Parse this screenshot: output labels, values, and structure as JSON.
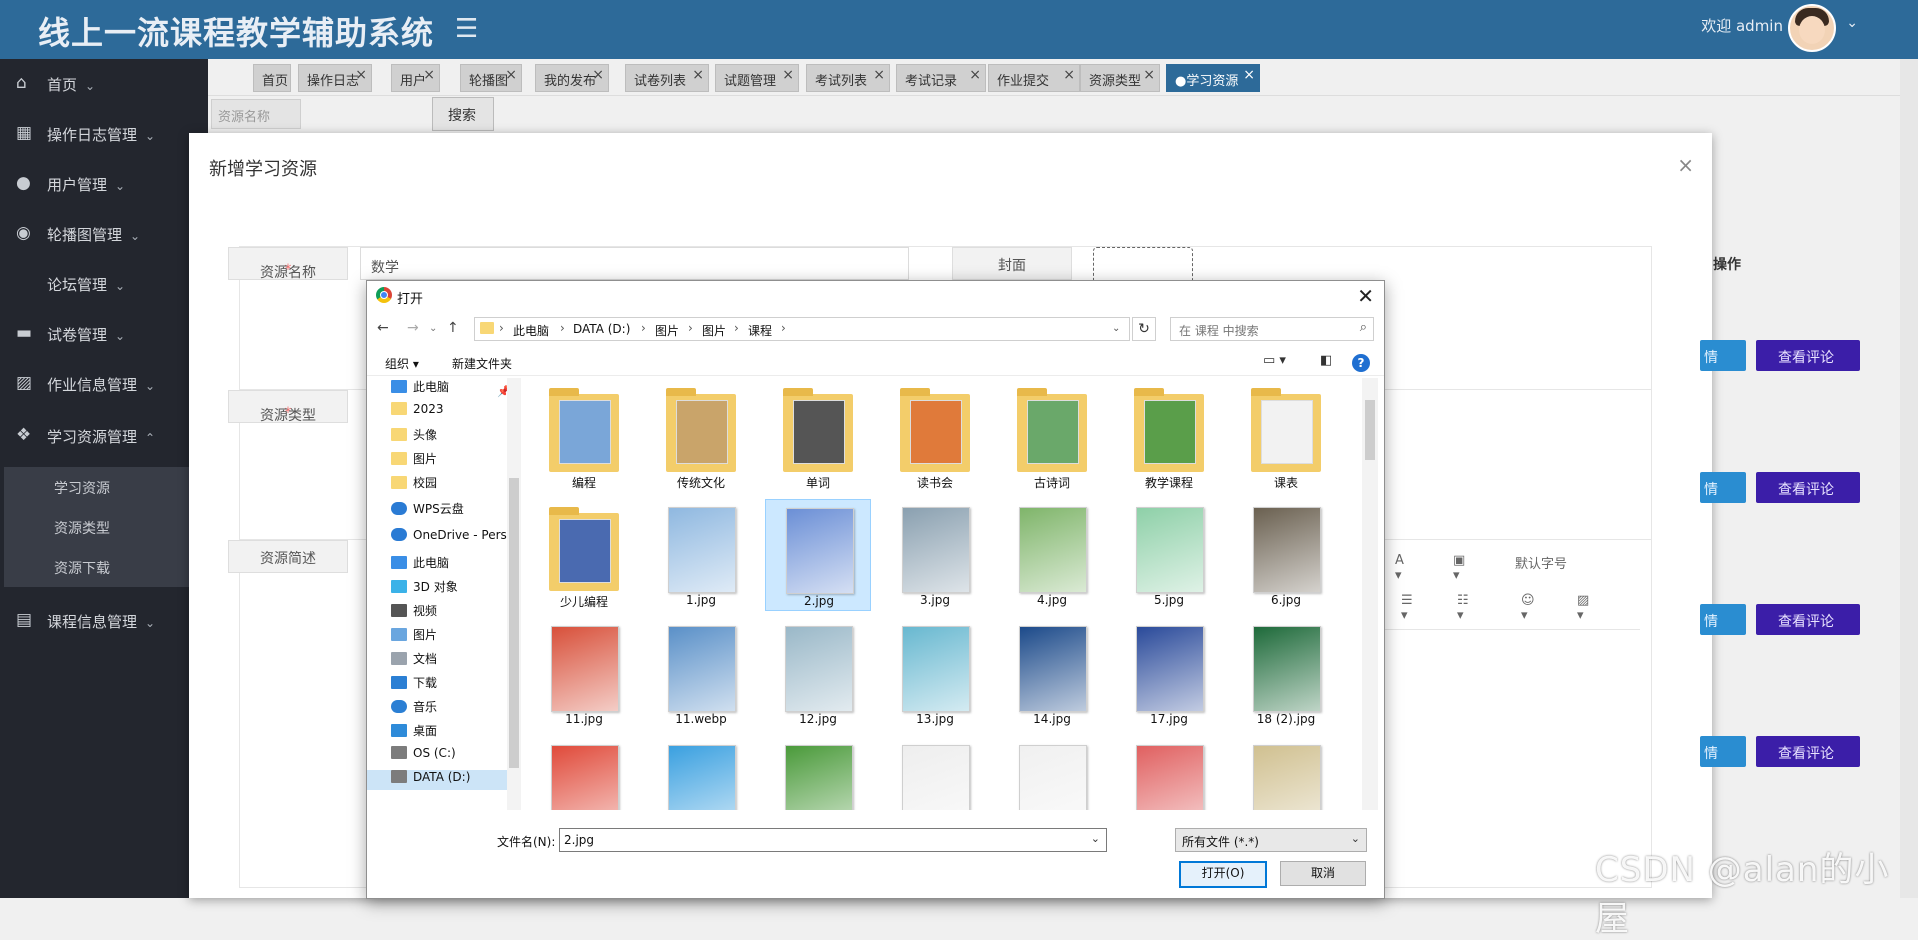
{
  "header": {
    "title": "线上一流课程教学辅助系统",
    "welcome": "欢迎 admin"
  },
  "sidebar": {
    "items": [
      {
        "label": "首页"
      },
      {
        "label": "操作日志管理"
      },
      {
        "label": "用户管理"
      },
      {
        "label": "轮播图管理"
      },
      {
        "label": "论坛管理"
      },
      {
        "label": "试卷管理"
      },
      {
        "label": "作业信息管理"
      },
      {
        "label": "学习资源管理"
      },
      {
        "label": "课程信息管理"
      }
    ],
    "subitems": [
      {
        "label": "学习资源"
      },
      {
        "label": "资源类型"
      },
      {
        "label": "资源下载"
      }
    ]
  },
  "tabs": [
    {
      "label": "首页"
    },
    {
      "label": "操作日志"
    },
    {
      "label": "用户"
    },
    {
      "label": "轮播图"
    },
    {
      "label": "我的发布"
    },
    {
      "label": "试卷列表"
    },
    {
      "label": "试题管理"
    },
    {
      "label": "考试列表"
    },
    {
      "label": "考试记录"
    },
    {
      "label": "作业提交"
    },
    {
      "label": "资源类型"
    },
    {
      "label": "●学习资源"
    }
  ],
  "search": {
    "placeholder": "资源名称",
    "button": "搜索"
  },
  "table": {
    "op_header": "操作",
    "comment_button": "查看评论",
    "edit_stub": "情"
  },
  "modal": {
    "title": "新增学习资源",
    "fields": {
      "name_label": "资源名称",
      "name_value": "数学",
      "cover_label": "封面",
      "type_label": "资源类型",
      "desc_label": "资源简述",
      "font_size": "默认字号"
    }
  },
  "dialog": {
    "title": "打开",
    "breadcrumbs": [
      "此电脑",
      "DATA (D:)",
      "图片",
      "图片",
      "课程"
    ],
    "search_placeholder": "在 课程 中搜索",
    "organize": "组织 ▾",
    "new_folder": "新建文件夹",
    "tree": [
      {
        "label": "此电脑",
        "icon": "pc"
      },
      {
        "label": "2023",
        "icon": "folder"
      },
      {
        "label": "头像",
        "icon": "folder"
      },
      {
        "label": "图片",
        "icon": "folder"
      },
      {
        "label": "校园",
        "icon": "folder"
      },
      {
        "label": "WPS云盘",
        "icon": "wps"
      },
      {
        "label": "OneDrive - Perso",
        "icon": "cloud"
      },
      {
        "label": "此电脑",
        "icon": "pc"
      },
      {
        "label": "3D 对象",
        "icon": "obj"
      },
      {
        "label": "视频",
        "icon": "video"
      },
      {
        "label": "图片",
        "icon": "pic"
      },
      {
        "label": "文档",
        "icon": "doc"
      },
      {
        "label": "下载",
        "icon": "down"
      },
      {
        "label": "音乐",
        "icon": "music"
      },
      {
        "label": "桌面",
        "icon": "desk"
      },
      {
        "label": "OS (C:)",
        "icon": "drive"
      },
      {
        "label": "DATA (D:)",
        "icon": "drive"
      }
    ],
    "files": [
      {
        "name": "编程",
        "kind": "folder",
        "color": "#7aa6d8"
      },
      {
        "name": "传统文化",
        "kind": "folder",
        "color": "#c9a46a"
      },
      {
        "name": "单词",
        "kind": "folder",
        "color": "#555555"
      },
      {
        "name": "读书会",
        "kind": "folder",
        "color": "#e07a3a"
      },
      {
        "name": "古诗词",
        "kind": "folder",
        "color": "#6aa86a"
      },
      {
        "name": "教学课程",
        "kind": "folder",
        "color": "#5a9e4a"
      },
      {
        "name": "课表",
        "kind": "folder",
        "color": "#f2f2f2"
      },
      {
        "name": "少儿编程",
        "kind": "folder",
        "color": "#4a6ab0"
      },
      {
        "name": "1.jpg",
        "kind": "image",
        "color": "#8fb8e0"
      },
      {
        "name": "2.jpg",
        "kind": "image",
        "color": "#6b8fd6",
        "selected": true
      },
      {
        "name": "3.jpg",
        "kind": "image",
        "color": "#8aa0b0"
      },
      {
        "name": "4.jpg",
        "kind": "image",
        "color": "#7fb56a"
      },
      {
        "name": "5.jpg",
        "kind": "image",
        "color": "#8ed0a8"
      },
      {
        "name": "6.jpg",
        "kind": "image",
        "color": "#6a6050"
      },
      {
        "name": "11.jpg",
        "kind": "image",
        "color": "#d8503a"
      },
      {
        "name": "11.webp",
        "kind": "image",
        "color": "#5a90c8"
      },
      {
        "name": "12.jpg",
        "kind": "image",
        "color": "#9ab8c8"
      },
      {
        "name": "13.jpg",
        "kind": "image",
        "color": "#68b8d0"
      },
      {
        "name": "14.jpg",
        "kind": "image",
        "color": "#1c4a8a"
      },
      {
        "name": "17.jpg",
        "kind": "image",
        "color": "#2a4a9a"
      },
      {
        "name": "18 (2).jpg",
        "kind": "image",
        "color": "#1e6a3a"
      }
    ],
    "filename_label": "文件名(N):",
    "filename_value": "2.jpg",
    "filetype": "所有文件 (*.*)",
    "open_button": "打开(O)",
    "cancel_button": "取消"
  },
  "watermark": "CSDN @alan的小屋",
  "colors": {
    "header": "#2d6a99",
    "sidebar": "#23262e",
    "comment_button": "#3b1ea8",
    "selection": "#cce8ff"
  }
}
